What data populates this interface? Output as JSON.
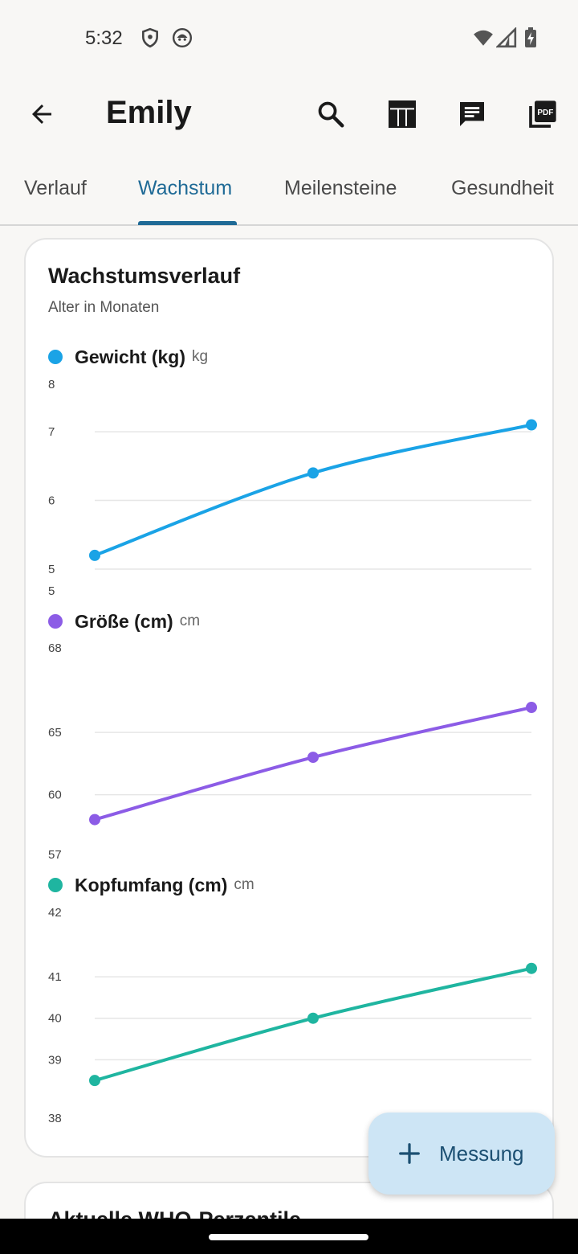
{
  "status_bar": {
    "time": "5:32",
    "left_icons": [
      "shield-icon",
      "android-face-icon"
    ],
    "right_icons": [
      "wifi-icon",
      "signal-icon",
      "battery-charging-icon"
    ]
  },
  "app_bar": {
    "title": "Emily",
    "back_icon": "arrow-back-icon",
    "actions": [
      "search-icon",
      "table-icon",
      "message-icon",
      "pdf-icon"
    ]
  },
  "tabs": {
    "items": [
      {
        "label": "Verlauf",
        "active": false
      },
      {
        "label": "Wachstum",
        "active": true
      },
      {
        "label": "Meilensteine",
        "active": false
      },
      {
        "label": "Gesundheit",
        "active": false
      }
    ],
    "active_color": "#1f6a96"
  },
  "card": {
    "title": "Wachstumsverlauf",
    "subtitle": "Alter in Monaten"
  },
  "chart_data": [
    {
      "type": "line",
      "name": "Gewicht (kg)",
      "unit": "kg",
      "color": "#1aa3e6",
      "x": [
        0,
        1,
        2
      ],
      "values": [
        5.2,
        6.4,
        7.1
      ],
      "yticks_top": "8",
      "yticks": [
        7,
        6,
        5
      ],
      "ytick_labels": [
        "7",
        "6",
        "5"
      ],
      "ylim": [
        5,
        7.2
      ],
      "ymin_label": "5",
      "grid": true
    },
    {
      "type": "line",
      "name": "Größe (cm)",
      "unit": "cm",
      "color": "#8c5ce6",
      "x": [
        0,
        1,
        2
      ],
      "values": [
        58,
        63,
        67
      ],
      "yticks_top": "68",
      "yticks": [
        65,
        60
      ],
      "ytick_labels": [
        "65",
        "60"
      ],
      "ylim": [
        57.2,
        70.1
      ],
      "ymin_label": "57",
      "grid": true
    },
    {
      "type": "line",
      "name": "Kopfumfang (cm)",
      "unit": "cm",
      "color": "#1fb5a0",
      "x": [
        0,
        1,
        2
      ],
      "values": [
        38.5,
        40,
        41.2
      ],
      "yticks_top": "42",
      "yticks": [
        41,
        40,
        39
      ],
      "ytick_labels": [
        "41",
        "40",
        "39"
      ],
      "ylim": [
        38,
        41.95
      ],
      "ymin_label": "38",
      "grid": true
    }
  ],
  "card2": {
    "title": "Aktuelle WHO-Perzentile"
  },
  "fab": {
    "label": "Messung",
    "icon": "plus-icon"
  },
  "colors": {
    "accent": "#1f6a96",
    "fab_background": "#cde5f5",
    "fab_text": "#1b4f72"
  }
}
